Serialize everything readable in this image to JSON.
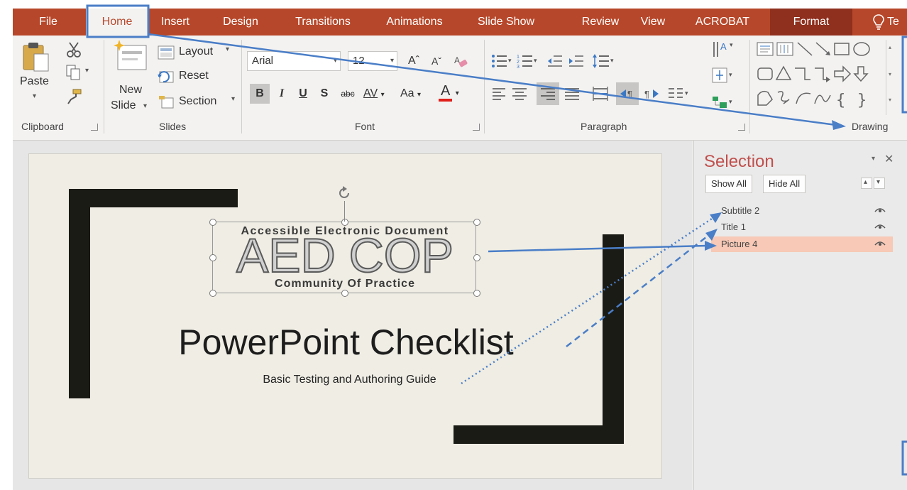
{
  "ribbon": {
    "tabs": [
      {
        "key": "file",
        "label": "File"
      },
      {
        "key": "home",
        "label": "Home"
      },
      {
        "key": "insert",
        "label": "Insert"
      },
      {
        "key": "design",
        "label": "Design"
      },
      {
        "key": "transitions",
        "label": "Transitions"
      },
      {
        "key": "animations",
        "label": "Animations"
      },
      {
        "key": "slideshow",
        "label": "Slide Show"
      },
      {
        "key": "review",
        "label": "Review"
      },
      {
        "key": "view",
        "label": "View"
      },
      {
        "key": "acrobat",
        "label": "ACROBAT"
      },
      {
        "key": "format",
        "label": "Format"
      }
    ],
    "tell_me": "Te",
    "active_tab": "Home",
    "clipboard": {
      "paste": "Paste",
      "label": "Clipboard"
    },
    "slides": {
      "new": "New",
      "slide": "Slide",
      "layout": "Layout",
      "reset": "Reset",
      "section": "Section",
      "label": "Slides"
    },
    "font": {
      "name": "Arial",
      "size": "12",
      "grow": "Aˆ",
      "shrink": "Aˇ",
      "bold": "B",
      "italic": "I",
      "underline": "U",
      "shadow": "S",
      "strike": "abc",
      "spacing": "AV",
      "case": "Aa",
      "color_a": "A",
      "label": "Font"
    },
    "paragraph": {
      "label": "Paragraph"
    },
    "drawing": {
      "label": "Drawing"
    }
  },
  "slide": {
    "logo_top": "Accessible Electronic Document",
    "logo_main": "AED COP",
    "logo_bottom": "Community Of Practice",
    "title": "PowerPoint Checklist",
    "subtitle": "Basic Testing and Authoring Guide"
  },
  "selection_pane": {
    "title": "Selection",
    "show_all": "Show All",
    "hide_all": "Hide All",
    "items": [
      {
        "name": "Subtitle 2",
        "selected": false
      },
      {
        "name": "Title 1",
        "selected": false
      },
      {
        "name": "Picture 4",
        "selected": true
      }
    ]
  },
  "colors": {
    "accent": "#b7472a",
    "callout": "#4a7ec7",
    "selection_highlight": "#f7c9b6",
    "slide_background": "#efede4",
    "frame": "#1b1b15"
  }
}
